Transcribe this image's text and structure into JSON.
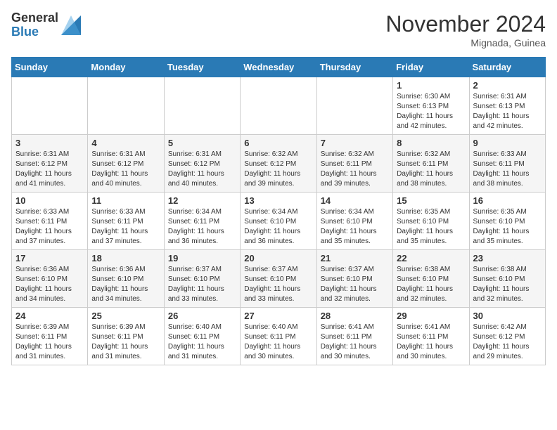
{
  "header": {
    "logo_general": "General",
    "logo_blue": "Blue",
    "month_title": "November 2024",
    "location": "Mignada, Guinea"
  },
  "weekdays": [
    "Sunday",
    "Monday",
    "Tuesday",
    "Wednesday",
    "Thursday",
    "Friday",
    "Saturday"
  ],
  "weeks": [
    [
      {
        "day": "",
        "info": ""
      },
      {
        "day": "",
        "info": ""
      },
      {
        "day": "",
        "info": ""
      },
      {
        "day": "",
        "info": ""
      },
      {
        "day": "",
        "info": ""
      },
      {
        "day": "1",
        "info": "Sunrise: 6:30 AM\nSunset: 6:13 PM\nDaylight: 11 hours\nand 42 minutes."
      },
      {
        "day": "2",
        "info": "Sunrise: 6:31 AM\nSunset: 6:13 PM\nDaylight: 11 hours\nand 42 minutes."
      }
    ],
    [
      {
        "day": "3",
        "info": "Sunrise: 6:31 AM\nSunset: 6:12 PM\nDaylight: 11 hours\nand 41 minutes."
      },
      {
        "day": "4",
        "info": "Sunrise: 6:31 AM\nSunset: 6:12 PM\nDaylight: 11 hours\nand 40 minutes."
      },
      {
        "day": "5",
        "info": "Sunrise: 6:31 AM\nSunset: 6:12 PM\nDaylight: 11 hours\nand 40 minutes."
      },
      {
        "day": "6",
        "info": "Sunrise: 6:32 AM\nSunset: 6:12 PM\nDaylight: 11 hours\nand 39 minutes."
      },
      {
        "day": "7",
        "info": "Sunrise: 6:32 AM\nSunset: 6:11 PM\nDaylight: 11 hours\nand 39 minutes."
      },
      {
        "day": "8",
        "info": "Sunrise: 6:32 AM\nSunset: 6:11 PM\nDaylight: 11 hours\nand 38 minutes."
      },
      {
        "day": "9",
        "info": "Sunrise: 6:33 AM\nSunset: 6:11 PM\nDaylight: 11 hours\nand 38 minutes."
      }
    ],
    [
      {
        "day": "10",
        "info": "Sunrise: 6:33 AM\nSunset: 6:11 PM\nDaylight: 11 hours\nand 37 minutes."
      },
      {
        "day": "11",
        "info": "Sunrise: 6:33 AM\nSunset: 6:11 PM\nDaylight: 11 hours\nand 37 minutes."
      },
      {
        "day": "12",
        "info": "Sunrise: 6:34 AM\nSunset: 6:11 PM\nDaylight: 11 hours\nand 36 minutes."
      },
      {
        "day": "13",
        "info": "Sunrise: 6:34 AM\nSunset: 6:10 PM\nDaylight: 11 hours\nand 36 minutes."
      },
      {
        "day": "14",
        "info": "Sunrise: 6:34 AM\nSunset: 6:10 PM\nDaylight: 11 hours\nand 35 minutes."
      },
      {
        "day": "15",
        "info": "Sunrise: 6:35 AM\nSunset: 6:10 PM\nDaylight: 11 hours\nand 35 minutes."
      },
      {
        "day": "16",
        "info": "Sunrise: 6:35 AM\nSunset: 6:10 PM\nDaylight: 11 hours\nand 35 minutes."
      }
    ],
    [
      {
        "day": "17",
        "info": "Sunrise: 6:36 AM\nSunset: 6:10 PM\nDaylight: 11 hours\nand 34 minutes."
      },
      {
        "day": "18",
        "info": "Sunrise: 6:36 AM\nSunset: 6:10 PM\nDaylight: 11 hours\nand 34 minutes."
      },
      {
        "day": "19",
        "info": "Sunrise: 6:37 AM\nSunset: 6:10 PM\nDaylight: 11 hours\nand 33 minutes."
      },
      {
        "day": "20",
        "info": "Sunrise: 6:37 AM\nSunset: 6:10 PM\nDaylight: 11 hours\nand 33 minutes."
      },
      {
        "day": "21",
        "info": "Sunrise: 6:37 AM\nSunset: 6:10 PM\nDaylight: 11 hours\nand 32 minutes."
      },
      {
        "day": "22",
        "info": "Sunrise: 6:38 AM\nSunset: 6:10 PM\nDaylight: 11 hours\nand 32 minutes."
      },
      {
        "day": "23",
        "info": "Sunrise: 6:38 AM\nSunset: 6:10 PM\nDaylight: 11 hours\nand 32 minutes."
      }
    ],
    [
      {
        "day": "24",
        "info": "Sunrise: 6:39 AM\nSunset: 6:11 PM\nDaylight: 11 hours\nand 31 minutes."
      },
      {
        "day": "25",
        "info": "Sunrise: 6:39 AM\nSunset: 6:11 PM\nDaylight: 11 hours\nand 31 minutes."
      },
      {
        "day": "26",
        "info": "Sunrise: 6:40 AM\nSunset: 6:11 PM\nDaylight: 11 hours\nand 31 minutes."
      },
      {
        "day": "27",
        "info": "Sunrise: 6:40 AM\nSunset: 6:11 PM\nDaylight: 11 hours\nand 30 minutes."
      },
      {
        "day": "28",
        "info": "Sunrise: 6:41 AM\nSunset: 6:11 PM\nDaylight: 11 hours\nand 30 minutes."
      },
      {
        "day": "29",
        "info": "Sunrise: 6:41 AM\nSunset: 6:11 PM\nDaylight: 11 hours\nand 30 minutes."
      },
      {
        "day": "30",
        "info": "Sunrise: 6:42 AM\nSunset: 6:12 PM\nDaylight: 11 hours\nand 29 minutes."
      }
    ]
  ]
}
